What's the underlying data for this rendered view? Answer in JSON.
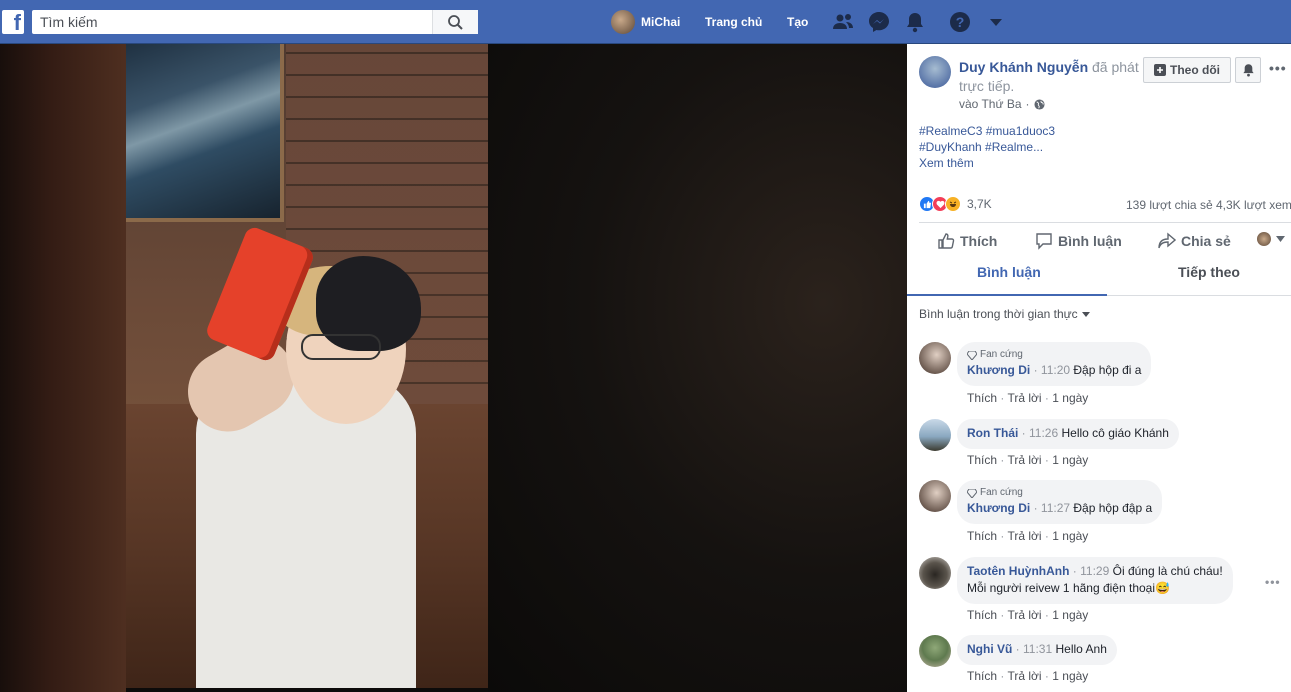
{
  "topbar": {
    "search_placeholder": "Tìm kiếm",
    "user_name": "MiChai",
    "home_label": "Trang chủ",
    "create_label": "Tạo"
  },
  "post": {
    "author": "Duy Khánh Nguyễn",
    "action": "đã phát trực tiếp.",
    "time": "vào Thứ Ba",
    "follow_label": "Theo dõi",
    "hashtags_line1": "#RealmeC3 #mua1duoc3",
    "hashtags_line2": "#DuyKhanh #Realme...",
    "see_more": "Xem thêm",
    "reaction_count": "3,7K",
    "share_stats": "139 lượt chia sẻ  4,3K lượt xem"
  },
  "actions": {
    "like": "Thích",
    "comment": "Bình luận",
    "share": "Chia sẻ"
  },
  "tabs": {
    "comments": "Bình luận",
    "next": "Tiếp theo"
  },
  "filter_label": "Bình luận trong thời gian thực",
  "comment_actions": {
    "like": "Thích",
    "reply": "Trả lời",
    "sep": "·"
  },
  "comments": [
    {
      "badge": "Fan cứng",
      "name": "Khương Di",
      "time": "11:20",
      "text": "Đập hộp đi a",
      "age": "1 ngày"
    },
    {
      "badge": "",
      "name": "Ron Thái",
      "time": "11:26",
      "text": "Hello cô giáo Khánh",
      "age": "1 ngày"
    },
    {
      "badge": "Fan cứng",
      "name": "Khương Di",
      "time": "11:27",
      "text": "Đập hộp đập a",
      "age": "1 ngày"
    },
    {
      "badge": "",
      "name": "Taotên HuỳnhAnh",
      "time": "11:29",
      "text": "Ôi đúng là chú cháu!",
      "text2": "Mỗi người reivew 1 hãng điện thoại😅",
      "age": "1 ngày"
    },
    {
      "badge": "",
      "name": "Nghi Vũ",
      "time": "11:31",
      "text": "Hello Anh",
      "age": "1 ngày"
    }
  ],
  "colors": {
    "brand": "#4267b2",
    "link": "#385898"
  }
}
